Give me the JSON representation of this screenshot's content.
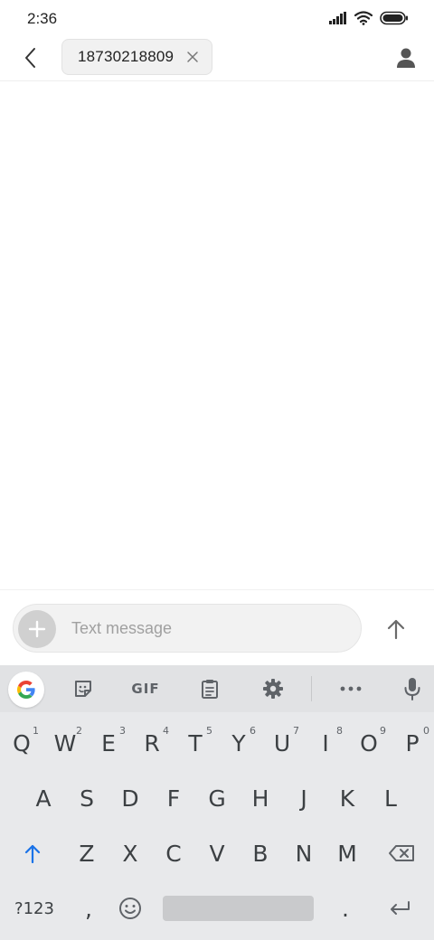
{
  "status_bar": {
    "time": "2:36",
    "icons": [
      "cellular-signal-icon",
      "wifi-icon",
      "battery-icon"
    ]
  },
  "header": {
    "back_icon": "chevron-left-icon",
    "recipient": "18730218809",
    "remove_icon": "close-icon",
    "contact_icon": "person-icon"
  },
  "compose": {
    "attach_icon": "plus-icon",
    "placeholder": "Text message",
    "value": "",
    "send_icon": "arrow-up-icon"
  },
  "keyboard": {
    "toolbar": {
      "google_icon": "google-g-icon",
      "sticker_icon": "sticker-icon",
      "gif_label": "GIF",
      "clipboard_icon": "clipboard-icon",
      "settings_icon": "gear-icon",
      "more_icon": "more-horizontal-icon",
      "mic_icon": "microphone-icon"
    },
    "row1": [
      {
        "label": "Q",
        "hint": "1"
      },
      {
        "label": "W",
        "hint": "2"
      },
      {
        "label": "E",
        "hint": "3"
      },
      {
        "label": "R",
        "hint": "4"
      },
      {
        "label": "T",
        "hint": "5"
      },
      {
        "label": "Y",
        "hint": "6"
      },
      {
        "label": "U",
        "hint": "7"
      },
      {
        "label": "I",
        "hint": "8"
      },
      {
        "label": "O",
        "hint": "9"
      },
      {
        "label": "P",
        "hint": "0"
      }
    ],
    "row2": [
      "A",
      "S",
      "D",
      "F",
      "G",
      "H",
      "J",
      "K",
      "L"
    ],
    "row3": [
      "Z",
      "X",
      "C",
      "V",
      "B",
      "N",
      "M"
    ],
    "shift_icon": "shift-arrow-icon",
    "backspace_icon": "backspace-icon",
    "symbols_label": "?123",
    "comma_label": ",",
    "emoji_icon": "emoji-icon",
    "period_label": ".",
    "enter_icon": "enter-icon"
  },
  "colors": {
    "accent": "#1a73e8",
    "keyboard_bg": "#e8e9eb",
    "icon_gray": "#5f6368"
  }
}
